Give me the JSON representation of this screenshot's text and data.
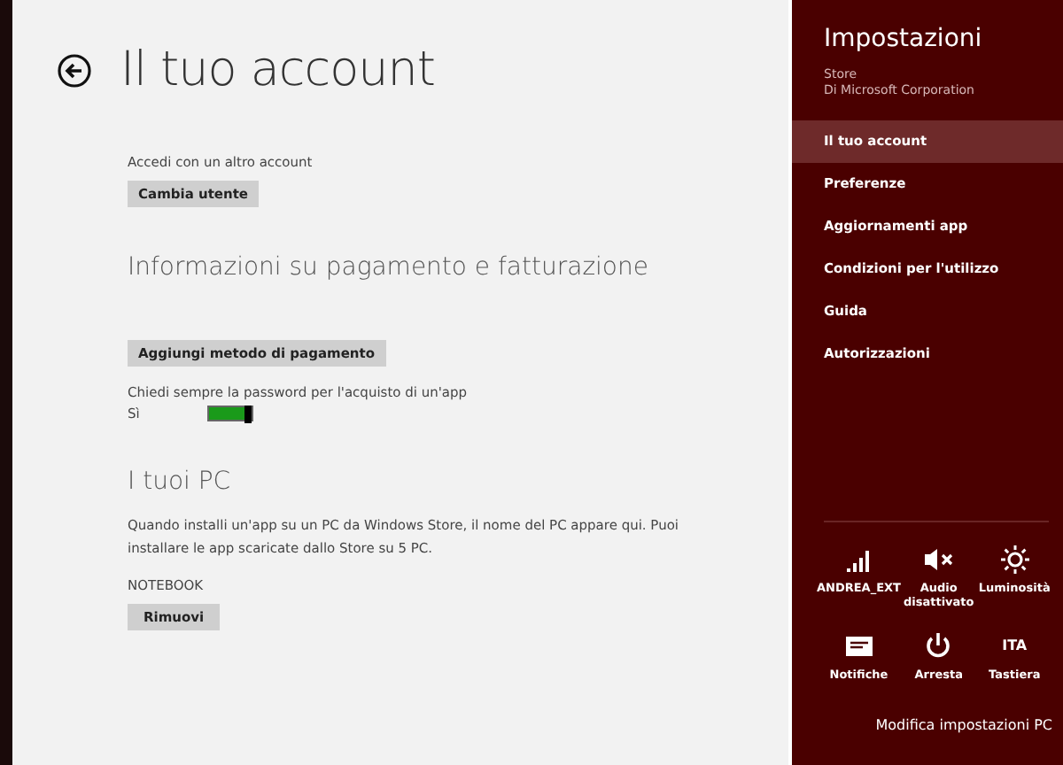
{
  "page": {
    "title": "Il tuo account"
  },
  "account": {
    "label": "Accedi con un altro account",
    "button": "Cambia utente"
  },
  "payment": {
    "heading": "Informazioni su pagamento e fatturazione",
    "button": "Aggiungi metodo di pagamento",
    "password_label": "Chiedi sempre la password per l'acquisto di un'app",
    "toggle": {
      "value": "Sì",
      "on": true
    }
  },
  "pcs": {
    "heading": "I tuoi PC",
    "description": "Quando installi un'app su un PC da Windows Store, il nome del PC appare qui. Puoi installare le app scaricate dallo Store su 5 PC.",
    "device": "NOTEBOOK",
    "button": "Rimuovi"
  },
  "settings": {
    "title": "Impostazioni",
    "app": "Store",
    "publisher": "Di Microsoft Corporation",
    "items": [
      {
        "label": "Il tuo account",
        "selected": true
      },
      {
        "label": "Preferenze",
        "selected": false
      },
      {
        "label": "Aggiornamenti app",
        "selected": false
      },
      {
        "label": "Condizioni per l'utilizzo",
        "selected": false
      },
      {
        "label": "Guida",
        "selected": false
      },
      {
        "label": "Autorizzazioni",
        "selected": false
      }
    ],
    "tiles": [
      {
        "kind": "signal",
        "label": "ANDREA_EXT"
      },
      {
        "kind": "mute",
        "label": "Audio disattivato"
      },
      {
        "kind": "brightness",
        "label": "Luminosità"
      },
      {
        "kind": "notifications",
        "label": "Notifiche"
      },
      {
        "kind": "power",
        "label": "Arresta"
      },
      {
        "kind": "text",
        "glyph": "ITA",
        "label": "Tastiera"
      }
    ],
    "link": "Modifica impostazioni PC"
  }
}
